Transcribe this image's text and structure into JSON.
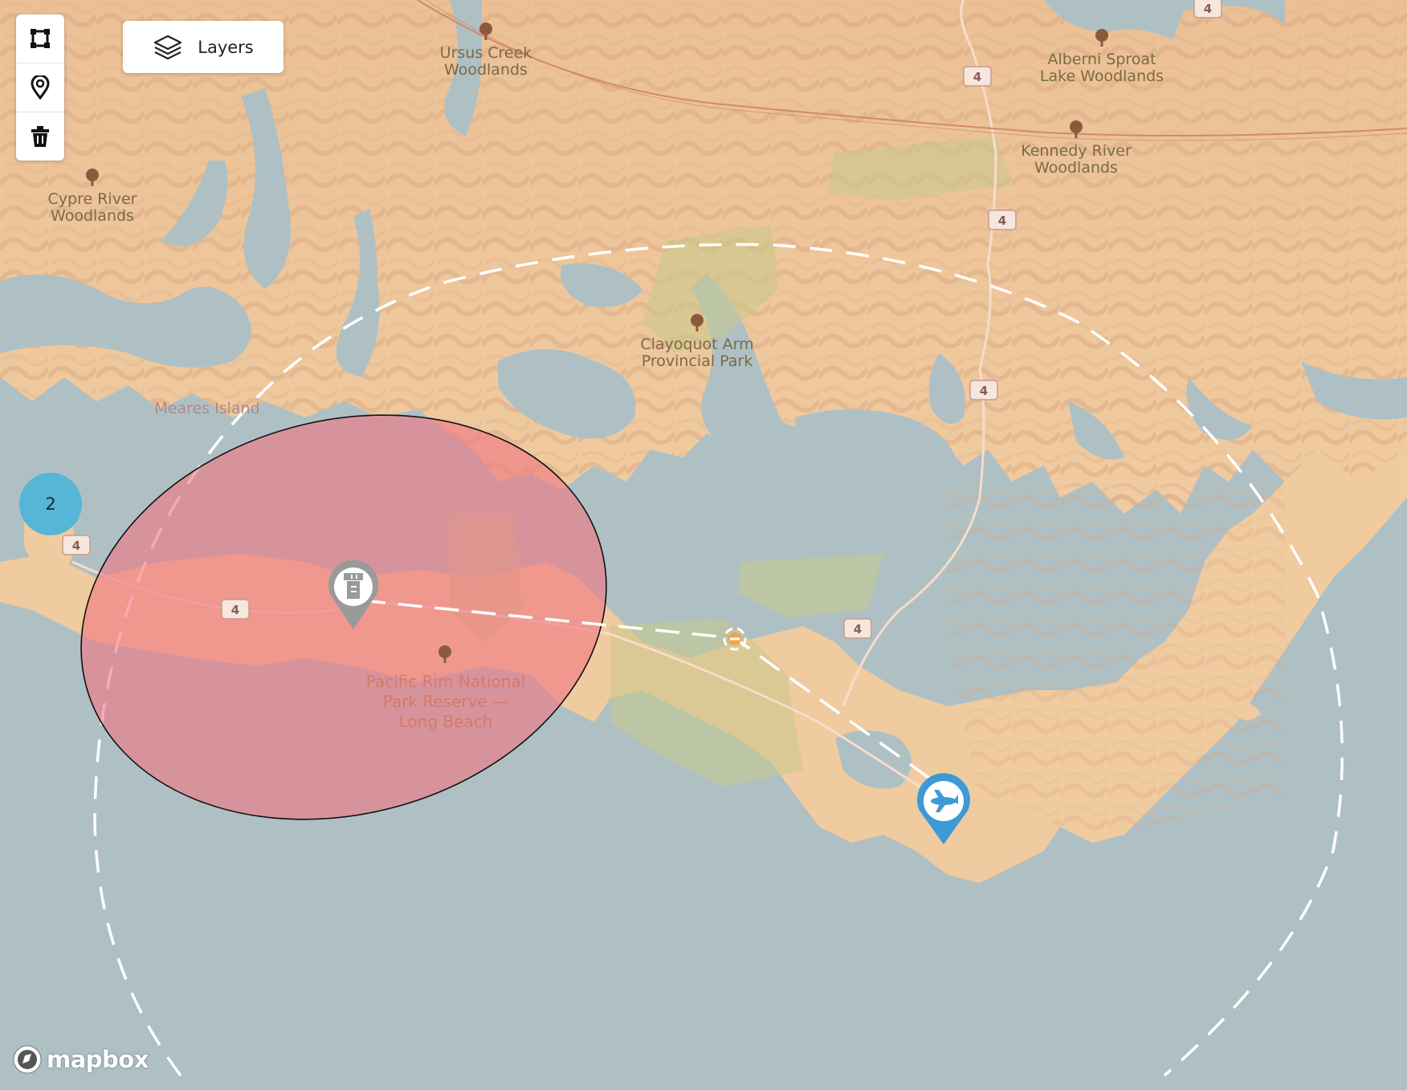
{
  "map": {
    "provider_logo": "mapbox",
    "places": [
      {
        "id": "ursus",
        "lines": [
          "Ursus Creek",
          "Woodlands"
        ],
        "icon": "tree-icon"
      },
      {
        "id": "alberni",
        "lines": [
          "Alberni Sproat",
          "Lake Woodlands"
        ],
        "icon": "tree-icon"
      },
      {
        "id": "kennedy",
        "lines": [
          "Kennedy River",
          "Woodlands"
        ],
        "icon": "tree-icon"
      },
      {
        "id": "cypre",
        "lines": [
          "Cypre River",
          "Woodlands"
        ],
        "icon": "tree-icon"
      },
      {
        "id": "clayoquot",
        "lines": [
          "Clayoquot Arm",
          "Provincial Park"
        ],
        "icon": "tree-icon"
      }
    ],
    "island_label": "Meares Island",
    "park_reserve": {
      "lines": [
        "Pacific Rim National",
        "Park Reserve —",
        "Long Beach"
      ],
      "icon": "tree-icon"
    },
    "highway_shield": "4",
    "markers": {
      "tower": {
        "icon": "control-tower-icon",
        "color": "#9a9a9a"
      },
      "airport": {
        "icon": "airplane-icon",
        "color": "#3d9ad4"
      },
      "waypoint": {
        "icon": "waypoint-icon",
        "color": "#f2a34a"
      }
    },
    "zone_color": "#f07882"
  },
  "toolbar": {
    "buttons": [
      {
        "name": "draw-polygon-button",
        "icon": "polygon-icon"
      },
      {
        "name": "draw-point-button",
        "icon": "map-pin-icon"
      },
      {
        "name": "delete-button",
        "icon": "trash-icon"
      }
    ]
  },
  "layers": {
    "label": "Layers",
    "icon": "layers-icon"
  },
  "cluster": {
    "count": "2"
  },
  "footer": {
    "logo_text": "mapbox"
  }
}
